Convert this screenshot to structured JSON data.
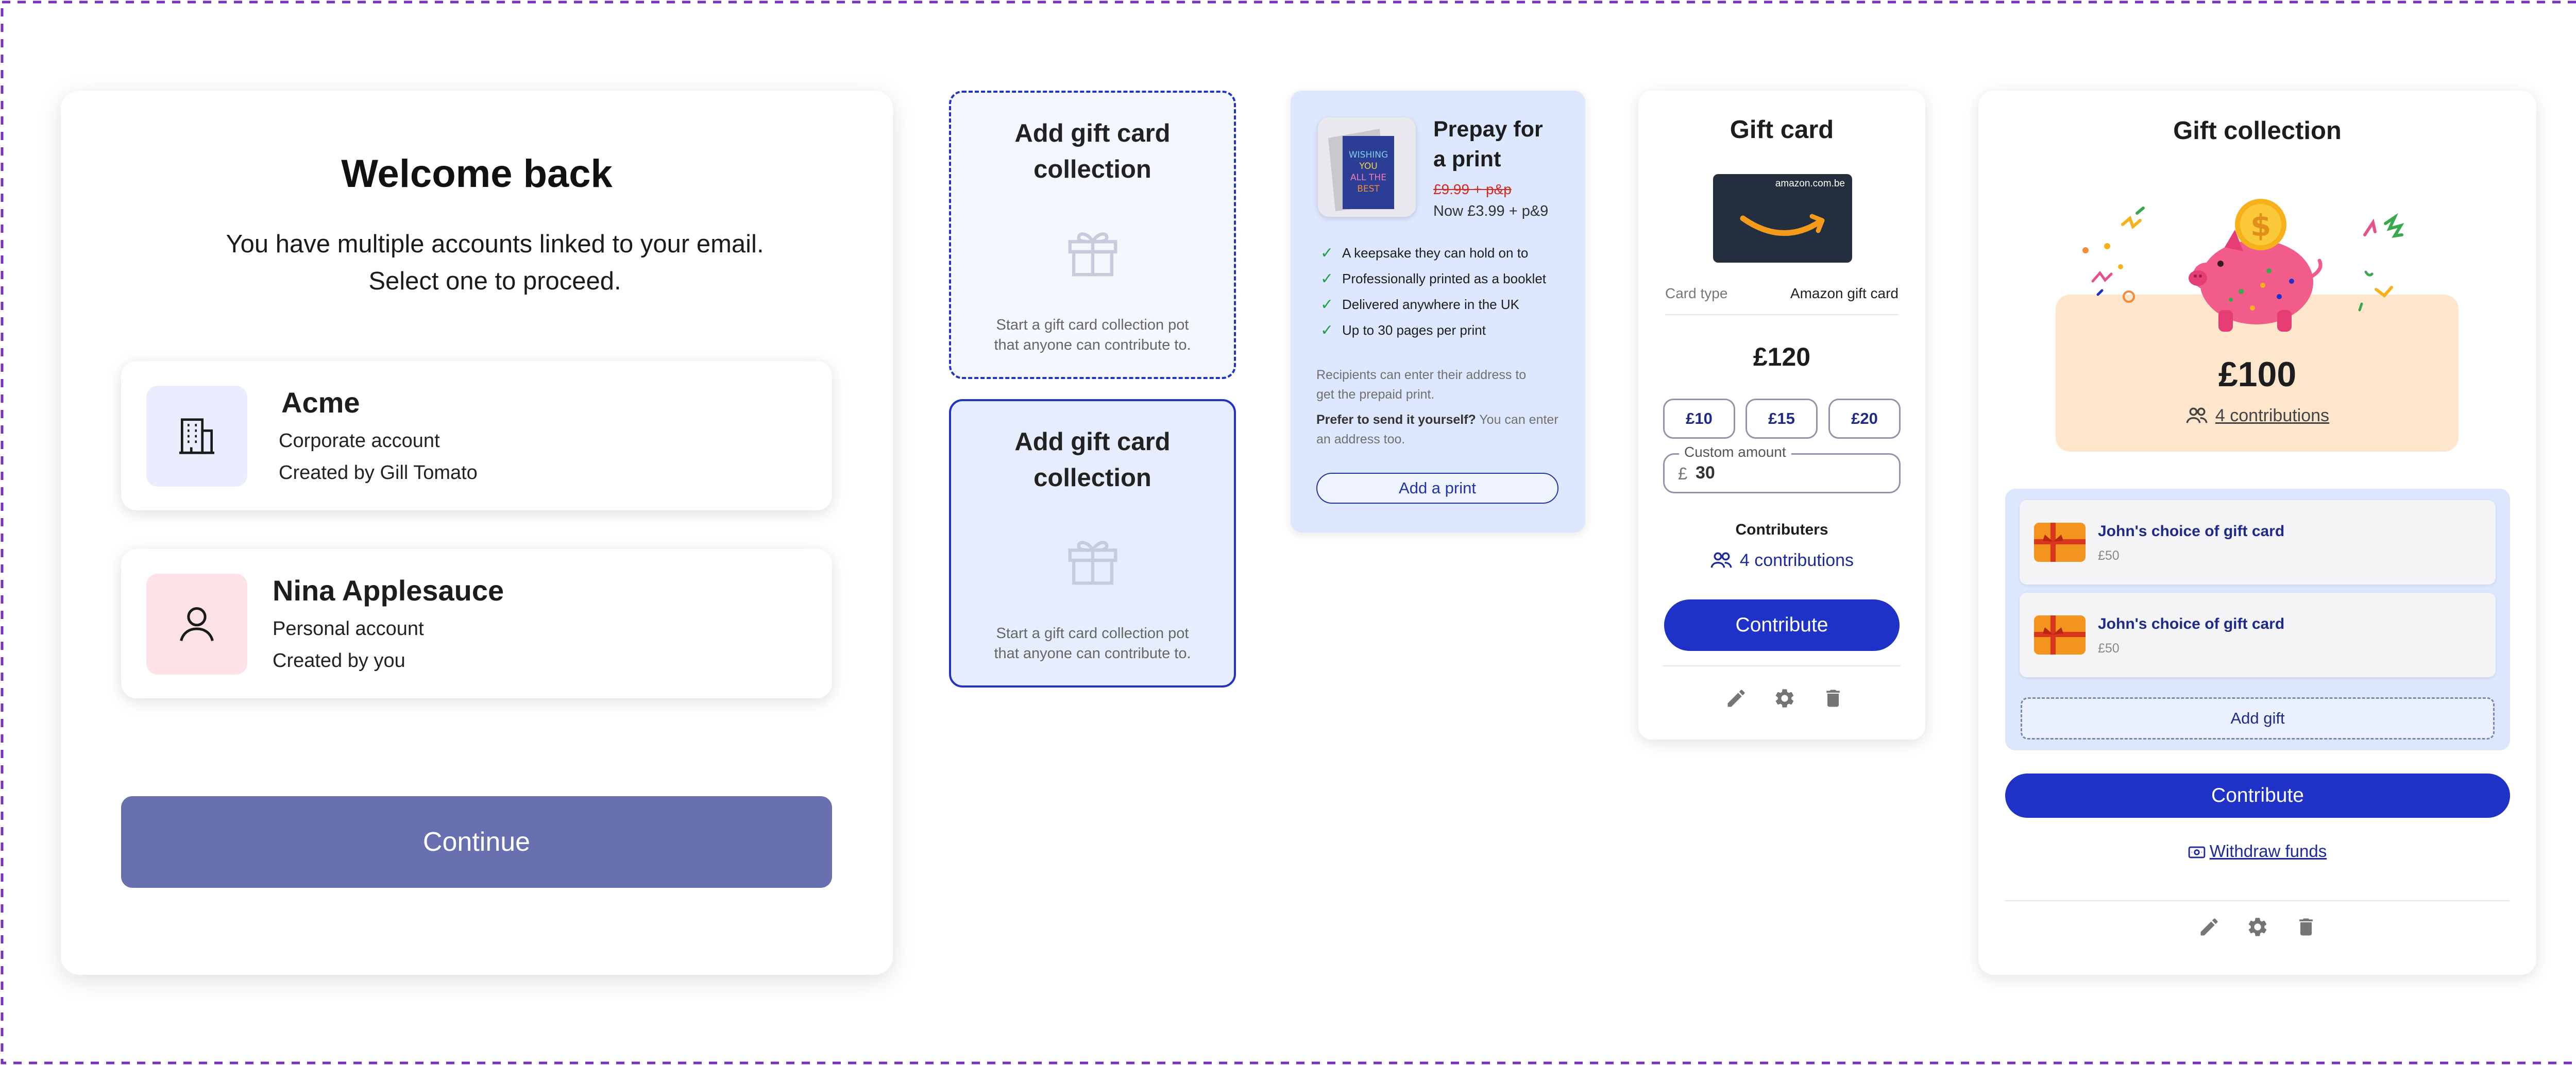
{
  "welcome": {
    "title": "Welcome back",
    "subtitle_line1": "You have multiple accounts linked to your email.",
    "subtitle_line2": "Select one to proceed.",
    "accounts": [
      {
        "name": "Acme",
        "type": "Corporate account",
        "created": "Created by Gill Tomato",
        "icon": "building-icon"
      },
      {
        "name": "Nina Applesauce",
        "type": "Personal account",
        "created": "Created by you",
        "icon": "person-icon"
      }
    ],
    "continue_label": "Continue"
  },
  "add_collection": {
    "title_line1": "Add gift card",
    "title_line2": "collection",
    "desc_line1": "Start a gift card collection pot",
    "desc_line2": "that anyone can contribute to.",
    "icon": "gift-icon"
  },
  "prepay": {
    "title_line1": "Prepay for",
    "title_line2": "a print",
    "old_price": "£9.99 + p&p",
    "new_price": "Now £3.99 + p&9",
    "card_text": [
      "WISHING",
      "YOU",
      "ALL THE",
      "BEST"
    ],
    "features": [
      "A keepsake they can hold on to",
      "Professionally printed as a booklet",
      "Delivered anywhere in the UK",
      "Up to 30 pages per print"
    ],
    "recipients_line1": "Recipients can enter their address to",
    "recipients_line2": "get the prepaid print.",
    "prefer_bold": "Prefer to send it yourself?",
    "prefer_rest_1": " You can enter",
    "prefer_rest_2": "an address too.",
    "button": "Add a print"
  },
  "gift_card": {
    "title": "Gift card",
    "brand_domain": "amazon.com.be",
    "card_type_label": "Card type",
    "card_type_value": "Amazon gift card",
    "amount": "£120",
    "chips": [
      "£10",
      "£15",
      "£20"
    ],
    "custom_label": "Custom amount",
    "currency": "£",
    "custom_value": "30",
    "contributors_heading": "Contributers",
    "contributions_link": "4 contributions",
    "contribute_label": "Contribute",
    "colors": {
      "accent": "#1e32c8",
      "amazon_bg": "#232f3e",
      "amazon_smile": "#f59a1b"
    }
  },
  "gift_collection": {
    "title": "Gift collection",
    "total": "£100",
    "contributions_link": "4 contributions",
    "gifts": [
      {
        "title": "John's choice of gift card",
        "price": "£50"
      },
      {
        "title": "John's choice of gift card",
        "price": "£50"
      }
    ],
    "add_gift_label": "Add gift",
    "contribute_label": "Contribute",
    "withdraw_label": "Withdraw funds",
    "colors": {
      "peach": "#fde6cc",
      "list_bg": "#dce6fd",
      "pig": "#f25c8a",
      "coin": "#f7b21b"
    }
  }
}
